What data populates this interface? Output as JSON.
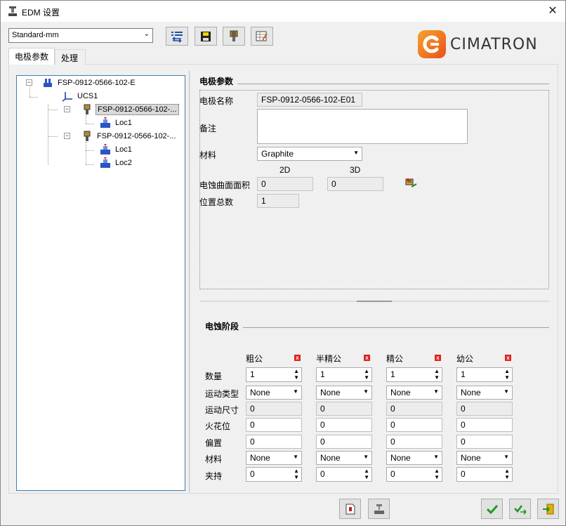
{
  "window": {
    "title": "EDM 设置",
    "close_glyph": "✕"
  },
  "toolbar": {
    "preset": "Standard-mm"
  },
  "logo": {
    "text": "CIMATRON"
  },
  "tabs": [
    "电极参数",
    "处理"
  ],
  "tree": {
    "root": "FSP-0912-0566-102-E",
    "ucs": "UCS1",
    "electrode1": "FSP-0912-0566-102-...",
    "e1_loc1": "Loc1",
    "electrode2": "FSP-0912-0566-102-...",
    "e2_loc1": "Loc1",
    "e2_loc2": "Loc2"
  },
  "electrode_params": {
    "section_title": "电极参数",
    "name_label": "电极名称",
    "name_value": "FSP-0912-0566-102-E01",
    "note_label": "备注",
    "note_value": "",
    "material_label": "材料",
    "material_value": "Graphite",
    "col_2d": "2D",
    "col_3d": "3D",
    "area_label": "电蚀曲面面积",
    "area_2d": "0",
    "area_3d": "0",
    "positions_label": "位置总数",
    "positions_value": "1"
  },
  "stages": {
    "section_title": "电蚀阶段",
    "columns": [
      "粗公",
      "半精公",
      "精公",
      "幼公"
    ],
    "x_glyph": "x",
    "row_labels": {
      "qty": "数量",
      "motion_type": "运动类型",
      "motion_size": "运动尺寸",
      "spark": "火花位",
      "offset": "偏置",
      "material": "材料",
      "holder": "夹持"
    },
    "values": {
      "qty": [
        "1",
        "1",
        "1",
        "1"
      ],
      "motion_type": [
        "None",
        "None",
        "None",
        "None"
      ],
      "motion_size": [
        "0",
        "0",
        "0",
        "0"
      ],
      "spark": [
        "0",
        "0",
        "0",
        "0"
      ],
      "offset": [
        "0",
        "0",
        "0",
        "0"
      ],
      "material": [
        "None",
        "None",
        "None",
        "None"
      ],
      "holder": [
        "0",
        "0",
        "0",
        "0"
      ]
    }
  }
}
